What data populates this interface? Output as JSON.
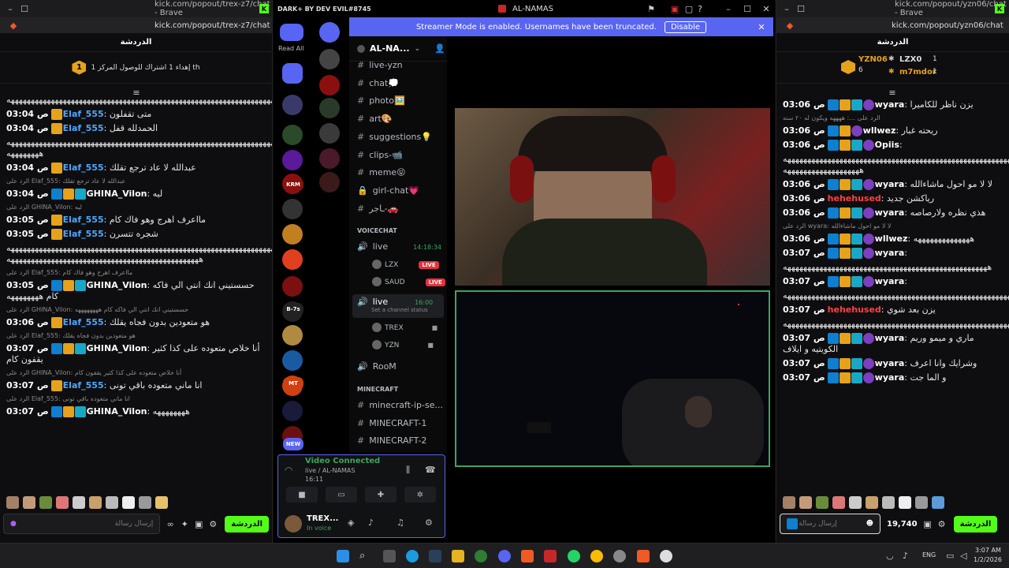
{
  "left_window": {
    "title_url": "kick.com/popout/trex-z7/chat - Brave",
    "address": "kick.com/popout/trex-z7/chat",
    "header": "الدردشة",
    "goal_text": "إهداء 1 اشتراك للوصول المركز 1 th",
    "goal_num": "1",
    "messages": [
      {
        "type": "text",
        "text": "ههههههههههههههههههههههههههههههههههههههههههههههههههههههههههههههههههههههههههههههه"
      },
      {
        "type": "msg",
        "time": "03:04 ص",
        "user": "Elaf_555",
        "color": "#4aa8ff",
        "badges": [
          "crown"
        ],
        "text": "متى تقفلون"
      },
      {
        "type": "msg",
        "time": "03:04 ص",
        "user": "Elaf_555",
        "color": "#4aa8ff",
        "badges": [
          "crown"
        ],
        "text": "الحمدلله قفل"
      },
      {
        "type": "text",
        "text": "هههههههههههههههههههههههههههههههههههههههههههههههههههههههههههههههههههههههههههه ههههههههه"
      },
      {
        "type": "msg",
        "time": "03:04 ص",
        "user": "Elaf_555",
        "color": "#4aa8ff",
        "badges": [
          "crown"
        ],
        "text": "عبدالله لا عاد ترجع تقلك"
      },
      {
        "type": "reply",
        "text": "الرد على Elaf_555: عبدالله لا عاد ترجع تقلك"
      },
      {
        "type": "msg",
        "time": "03:04 ص",
        "user": "GHINA_Vilon",
        "color": "#fff",
        "badges": [
          "mod",
          "crown",
          "vip"
        ],
        "text": "ليه"
      },
      {
        "type": "reply",
        "text": "الرد على GHINA_Vilon: ليه"
      },
      {
        "type": "msg",
        "time": "03:05 ص",
        "user": "Elaf_555",
        "color": "#4aa8ff",
        "badges": [
          "crown"
        ],
        "text": "مااعرف اهرج وهو فاك كام"
      },
      {
        "type": "msg",
        "time": "03:05 ص",
        "user": "Elaf_555",
        "color": "#4aa8ff",
        "badges": [
          "crown"
        ],
        "text": "شجره تتسرن"
      },
      {
        "type": "text",
        "text": "هههههههههههههههههههههههههههههههههههههههههههههههههههههههههههههههههههههه ههههههههههههههههههههههههههههههههههههههههههههههههه"
      },
      {
        "type": "reply",
        "text": "الرد على Elaf_555: مااعرف اهرج وهو فاك كام"
      },
      {
        "type": "msg",
        "time": "03:05 ص",
        "user": "GHINA_Vilon",
        "color": "#fff",
        "badges": [
          "mod",
          "crown",
          "vip"
        ],
        "text": "حسستيني انك انتي الي فاكه كام ههههههههه"
      },
      {
        "type": "reply",
        "text": "الرد على GHINA_Vilon: حسستيني انك انتي الي فاكه كام ههههههههه"
      },
      {
        "type": "msg",
        "time": "03:06 ص",
        "user": "Elaf_555",
        "color": "#4aa8ff",
        "badges": [
          "crown"
        ],
        "text": "هو متعودين بدون فجاه يقلك"
      },
      {
        "type": "reply",
        "text": "الرد على Elaf_555: هو متعودين بدون فجاه يقلك"
      },
      {
        "type": "msg",
        "time": "03:07 ص",
        "user": "GHINA_Vilon",
        "color": "#fff",
        "badges": [
          "mod",
          "crown",
          "vip"
        ],
        "text": "أنا خلاص متعوده على كذا كثير يقفون كام"
      },
      {
        "type": "reply",
        "text": "الرد على GHINA_Vilon: أنا خلاص متعوده على كذا كثير يقفون كام"
      },
      {
        "type": "msg",
        "time": "03:07 ص",
        "user": "Elaf_555",
        "color": "#4aa8ff",
        "badges": [
          "crown"
        ],
        "text": "انا ماني متعوده باقي تونى"
      },
      {
        "type": "reply",
        "text": "الرد على Elaf_555: انا ماني متعوده باقي تونى"
      },
      {
        "type": "msg",
        "time": "03:07 ص",
        "user": "GHINA_Vilon",
        "color": "#fff",
        "badges": [
          "mod",
          "crown",
          "vip"
        ],
        "text": "ههههههههه"
      }
    ],
    "input_placeholder": "إرسال رسالة",
    "chat_button": "الدردشة"
  },
  "discord": {
    "app_title": "DARK+ BY DEV EVIL#8745",
    "window_title": "AL-NAMAS",
    "banner_text": "Streamer Mode is enabled. Usernames have been truncated.",
    "banner_button": "Disable",
    "read_all": "Read All",
    "server_name": "AL-NA...",
    "server_labels": [
      "KRM",
      "B-7s",
      "MT",
      "NEW"
    ],
    "channels": [
      {
        "name": "live-yzn",
        "type": "text"
      },
      {
        "name": "chat💭",
        "type": "text"
      },
      {
        "name": "photo🖼️",
        "type": "text"
      },
      {
        "name": "art🎨",
        "type": "text"
      },
      {
        "name": "suggestions💡",
        "type": "text"
      },
      {
        "name": "clips-📹",
        "type": "text"
      },
      {
        "name": "meme😝",
        "type": "text"
      },
      {
        "name": "girl-chat💗",
        "type": "lock"
      },
      {
        "name": "ـاجر-🚗",
        "type": "text"
      }
    ],
    "voice_category": "VOICECHAT",
    "voice1": {
      "name": "live",
      "time": "14:18:34",
      "users": [
        {
          "name": "LZX",
          "badge": "LIVE"
        },
        {
          "name": "SAUD",
          "badge": "LIVE"
        }
      ]
    },
    "voice2": {
      "name": "live",
      "time": "16:00",
      "status": "Set a channel status",
      "users": [
        {
          "name": "TREX"
        },
        {
          "name": "YZN"
        }
      ]
    },
    "room": "RooM",
    "mc_category": "MINECRAFT",
    "mc_channels": [
      "minecraft-ip-se...",
      "MINECRAFT-1",
      "MINECRAFT-2"
    ],
    "voice_panel": {
      "title": "Video Connected",
      "sub": "live / AL-NAMAS",
      "time": "16:11"
    },
    "user_panel": {
      "name": "TREX...",
      "status": "In voice"
    }
  },
  "right_window": {
    "title_url": "kick.com/popout/yzn06/chat - Brave",
    "address": "kick.com/popout/yzn06/chat",
    "header": "الدردشة",
    "leaders": [
      {
        "name": "YZN06",
        "count": "6"
      },
      {
        "name": "LZX0",
        "count": "1"
      },
      {
        "name": "m7mdor",
        "count": "1"
      }
    ],
    "messages": [
      {
        "type": "msg",
        "time": "03:06 ص",
        "user": "wyara",
        "color": "#fff",
        "badges": [
          "mod",
          "crown",
          "vip",
          "circle"
        ],
        "text": "يزن ناظر للكاميرا"
      },
      {
        "type": "reply",
        "text": "الرد على ...: ههههه ويكون له ٢٠ سنه"
      },
      {
        "type": "msg",
        "time": "03:06 ص",
        "user": "wllwez",
        "color": "#fff",
        "badges": [
          "mod",
          "crown",
          "circle"
        ],
        "text": "ريحته غبار"
      },
      {
        "type": "msg",
        "time": "03:06 ص",
        "user": "Opiis",
        "color": "#fff",
        "badges": [
          "mod",
          "crown",
          "vip",
          "circle"
        ],
        "text": ""
      },
      {
        "type": "text",
        "text": "هههههههههههههههههههههههههههههههههههههههههههههههههههههههههههههههههههه هههههههههههههههههههه"
      },
      {
        "type": "msg",
        "time": "03:06 ص",
        "user": "wyara",
        "color": "#fff",
        "badges": [
          "mod",
          "crown",
          "vip",
          "circle"
        ],
        "text": "لا لا مو احول ماشاءالله"
      },
      {
        "type": "msg",
        "time": "03:06 ص",
        "user": "hehehused",
        "color": "#ff4040",
        "badges": [],
        "text": "رياكشن جديد"
      },
      {
        "type": "msg",
        "time": "03:06 ص",
        "user": "wyara",
        "color": "#fff",
        "badges": [
          "mod",
          "crown",
          "vip",
          "circle"
        ],
        "text": "هذي نظره ولارصاصه"
      },
      {
        "type": "reply",
        "text": "الرد على wyara: لا لا مو احول ماشاءالله"
      },
      {
        "type": "msg",
        "time": "03:06 ص",
        "user": "wllwez",
        "color": "#fff",
        "badges": [
          "mod",
          "crown",
          "vip",
          "circle"
        ],
        "text": "ههههههههههههههه"
      },
      {
        "type": "msg",
        "time": "03:07 ص",
        "user": "wyara",
        "color": "#fff",
        "badges": [
          "mod",
          "crown",
          "vip",
          "circle"
        ],
        "text": ""
      },
      {
        "type": "text",
        "text": "هههههههههههههههههههههههههههههههههههههههههههههههههههه"
      },
      {
        "type": "msg",
        "time": "03:07 ص",
        "user": "wyara",
        "color": "#fff",
        "badges": [
          "mod",
          "crown",
          "vip",
          "circle"
        ],
        "text": ""
      },
      {
        "type": "text",
        "text": "هههههههههههههههههههههههههههههههههههههههههههههههههههههههههههههههههههه"
      },
      {
        "type": "msg",
        "time": "03:07 ص",
        "user": "hehehused",
        "color": "#ff4040",
        "badges": [],
        "text": "يزن بعد شوي"
      },
      {
        "type": "text",
        "text": "هههههههههههههههههههههههههههههههههههههههههههههههههههههههههههههههههههههههه"
      },
      {
        "type": "msg",
        "time": "03:07 ص",
        "user": "wyara",
        "color": "#fff",
        "badges": [
          "mod",
          "crown",
          "vip",
          "circle"
        ],
        "text": "ماري و ميمو وريم الكويتيه و ايلاف"
      },
      {
        "type": "msg",
        "time": "03:07 ص",
        "user": "wyara",
        "color": "#fff",
        "badges": [
          "mod",
          "crown",
          "vip",
          "circle"
        ],
        "text": "وشرايك وانا اعرف"
      },
      {
        "type": "msg",
        "time": "03:07 ص",
        "user": "wyara",
        "color": "#fff",
        "badges": [
          "mod",
          "crown",
          "vip",
          "circle"
        ],
        "text": "و الما جت"
      }
    ],
    "input_placeholder": "إرسال رسالة",
    "points": "19,740",
    "chat_button": "الدردشة"
  },
  "taskbar": {
    "lang": "ENG",
    "time": "3:07 AM",
    "date": "1/2/2026"
  }
}
